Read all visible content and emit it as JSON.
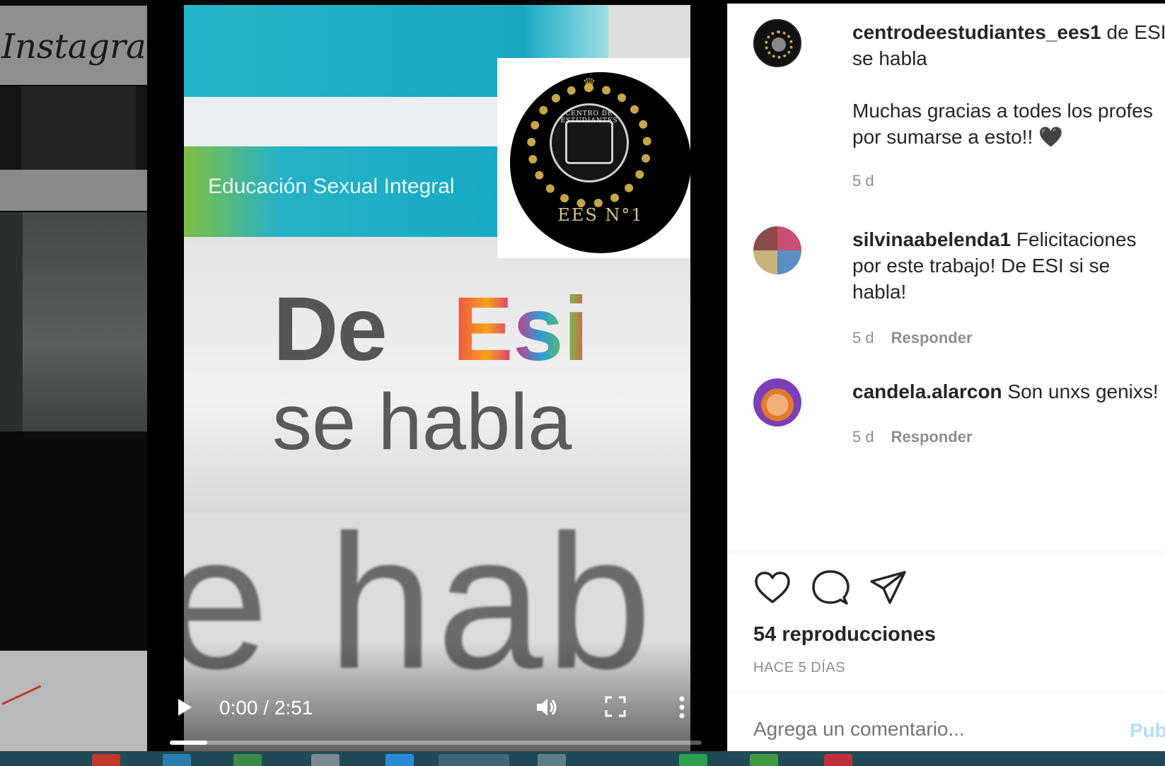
{
  "background": {
    "instagram_logo_text": "Instagram"
  },
  "video": {
    "band_text": "Educación Sexual Integral",
    "title_de": "De",
    "title_esi": "Esi",
    "title_sehabla": "se habla",
    "big_text": "e hab",
    "badge_caption": "EES N°1",
    "badge_arc_text": "CENTRO DE ESTUDIANTES",
    "controls": {
      "time": "0:00 / 2:51",
      "progress_fraction": 0.07
    }
  },
  "post": {
    "comments": [
      {
        "username": "centrodeestudiantes_ees1",
        "text": "de ESI se habla",
        "text2": "Muchas gracias a todes los profes por sumarse a esto!! 🖤",
        "age": "5 d",
        "reply": ""
      },
      {
        "username": "silvinaabelenda1",
        "text": "Felicitaciones por este trabajo! De ESI si se habla!",
        "age": "5 d",
        "reply": "Responder"
      },
      {
        "username": "candela.alarcon",
        "text": "Son unxs genixs!",
        "age": "5 d",
        "reply": "Responder"
      }
    ],
    "views": "54 reproducciones",
    "posted": "HACE 5 DÍAS",
    "comment_placeholder": "Agrega un comentario...",
    "publish_label": "Publicar"
  },
  "colors": {
    "accent_publish": "#b2dffc",
    "text_primary": "#262626",
    "text_secondary": "#8e8e8e",
    "taskbar": "#1f4b57"
  },
  "icons": [
    "play-icon",
    "volume-icon",
    "fullscreen-icon",
    "more-options-icon",
    "heart-icon",
    "comment-icon",
    "share-icon"
  ]
}
